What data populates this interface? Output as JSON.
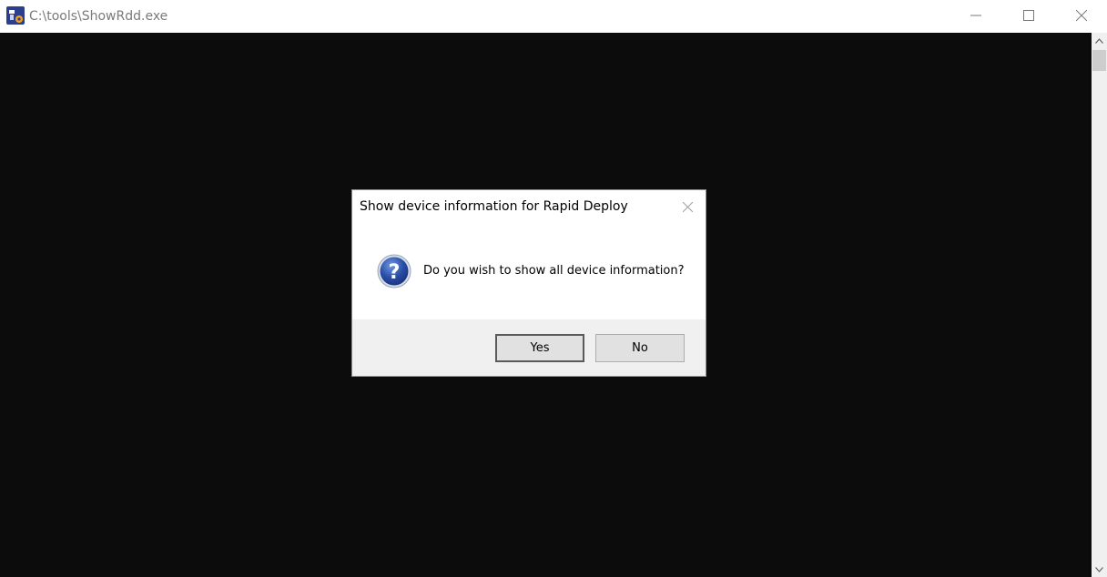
{
  "window": {
    "title": "C:\\tools\\ShowRdd.exe",
    "icon": "application-icon",
    "controls": {
      "minimize_icon": "minimize-icon",
      "maximize_icon": "maximize-icon",
      "close_icon": "close-icon"
    }
  },
  "console": {
    "background_color": "#0c0c0c"
  },
  "dialog": {
    "title": "Show device information for Rapid Deploy",
    "icon": "question-icon",
    "message": "Do you wish to show all device information?",
    "buttons": {
      "yes_label": "Yes",
      "no_label": "No"
    },
    "default_button": "Yes"
  },
  "colors": {
    "console_bg": "#0c0c0c",
    "dialog_footer_bg": "#f0f0f0",
    "question_icon_blue": "#2a4fa6"
  }
}
